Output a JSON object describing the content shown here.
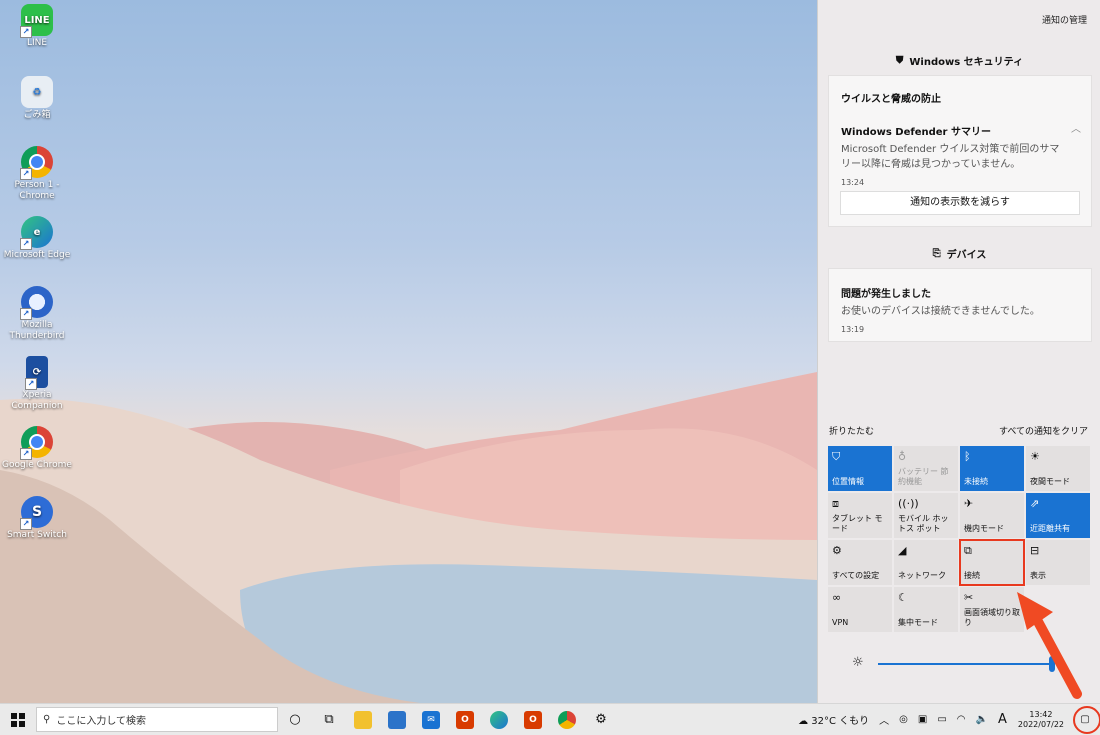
{
  "desktop": {
    "icons": [
      {
        "label": "LINE",
        "icon": "line-app-icon"
      },
      {
        "label": "ごみ箱",
        "icon": "recycle-bin-icon"
      },
      {
        "label": "Person 1 - Chrome",
        "icon": "chrome-profile-icon"
      },
      {
        "label": "Microsoft Edge",
        "icon": "edge-icon"
      },
      {
        "label": "Mozilla Thunderbird",
        "icon": "thunderbird-icon"
      },
      {
        "label": "Xperia Companion",
        "icon": "xperia-companion-icon"
      },
      {
        "label": "Google Chrome",
        "icon": "chrome-icon"
      },
      {
        "label": "Smart Switch",
        "icon": "smart-switch-icon"
      }
    ]
  },
  "action_center": {
    "manage_label": "通知の管理",
    "groups": [
      {
        "title": "Windows セキュリティ",
        "icon": "shield-icon",
        "card": {
          "heading": "ウイルスと脅威の防止",
          "subheading": "Windows Defender サマリー",
          "body": "Microsoft Defender ウイルス対策で前回のサマリー以降に脅威は見つかっていません。",
          "time": "13:24",
          "button": "通知の表示数を減らす"
        }
      },
      {
        "title": "デバイス",
        "icon": "devices-icon",
        "card": {
          "heading": "問題が発生しました",
          "body": "お使いのデバイスは接続できませんでした。",
          "time": "13:19"
        }
      }
    ],
    "collapse_label": "折りたたむ",
    "clear_all_label": "すべての通知をクリア",
    "tiles": [
      {
        "label": "位置情報",
        "icon": "location-icon",
        "state": "on"
      },
      {
        "label": "バッテリー 節約機能",
        "icon": "battery-saver-icon",
        "state": "disabled"
      },
      {
        "label": "未接続",
        "icon": "bluetooth-icon",
        "state": "on"
      },
      {
        "label": "夜間モード",
        "icon": "night-light-icon",
        "state": "off"
      },
      {
        "label": "タブレット モード",
        "icon": "tablet-mode-icon",
        "state": "off"
      },
      {
        "label": "モバイル ホットス ポット",
        "icon": "mobile-hotspot-icon",
        "state": "off"
      },
      {
        "label": "機内モード",
        "icon": "airplane-icon",
        "state": "off"
      },
      {
        "label": "近距離共有",
        "icon": "nearby-share-icon",
        "state": "on"
      },
      {
        "label": "すべての設定",
        "icon": "settings-gear-icon",
        "state": "off"
      },
      {
        "label": "ネットワーク",
        "icon": "network-icon",
        "state": "off"
      },
      {
        "label": "接続",
        "icon": "connect-icon",
        "state": "highlighted"
      },
      {
        "label": "表示",
        "icon": "project-icon",
        "state": "off"
      },
      {
        "label": "VPN",
        "icon": "vpn-icon",
        "state": "off"
      },
      {
        "label": "集中モード",
        "icon": "focus-assist-icon",
        "state": "off"
      },
      {
        "label": "画面領域切り取り",
        "icon": "screen-snip-icon",
        "state": "off"
      }
    ],
    "brightness": 1.0
  },
  "taskbar": {
    "search_placeholder": "ここに入力して検索",
    "weather": "32°C くもり",
    "ime": "A",
    "clock_time": "13:42",
    "clock_date": "2022/07/22"
  },
  "colors": {
    "accent": "#1a73d2",
    "highlight": "#e8391f"
  }
}
